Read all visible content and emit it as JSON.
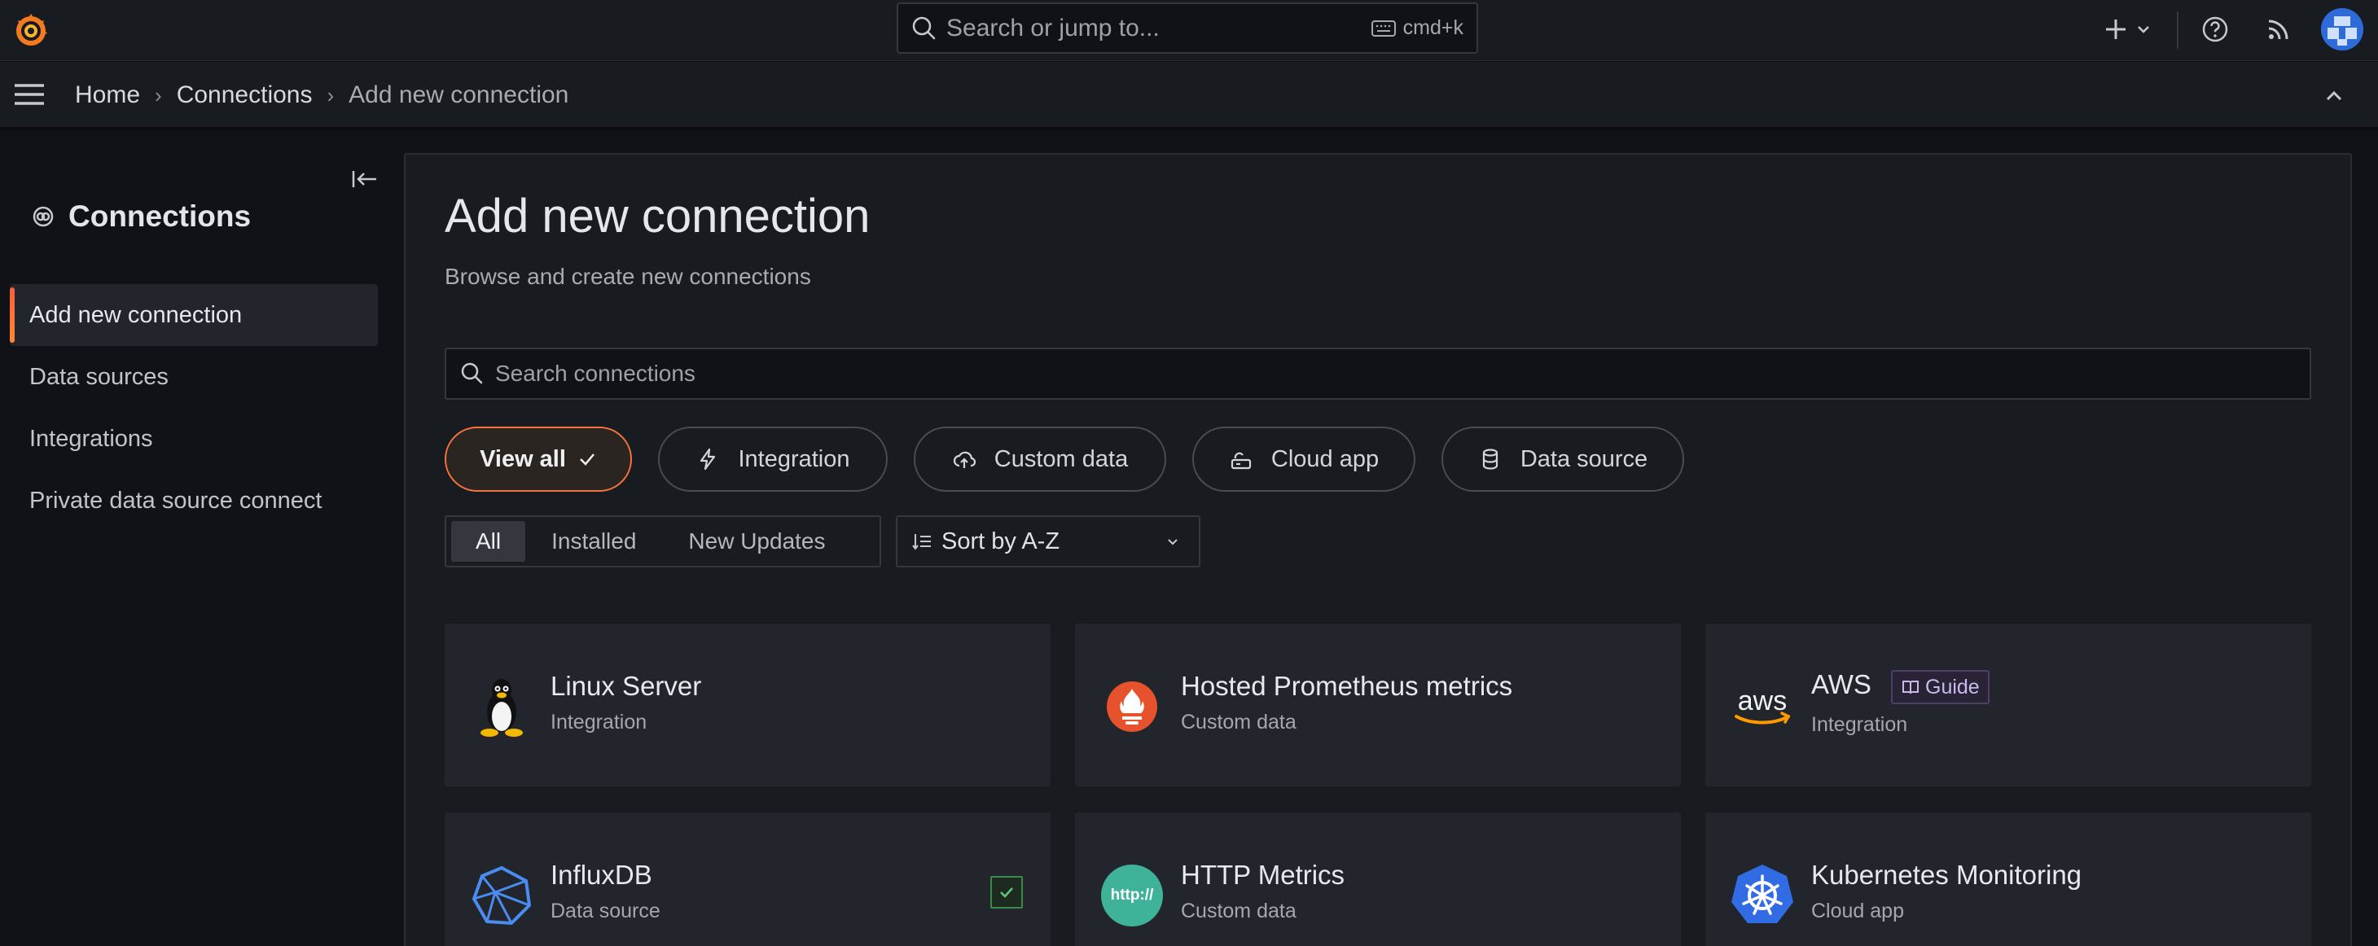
{
  "topbar": {
    "search_placeholder": "Search or jump to...",
    "shortcut": "cmd+k"
  },
  "breadcrumb": [
    {
      "label": "Home"
    },
    {
      "label": "Connections"
    },
    {
      "label": "Add new connection"
    }
  ],
  "sidebar": {
    "title": "Connections",
    "items": [
      {
        "label": "Add new connection",
        "active": true
      },
      {
        "label": "Data sources",
        "active": false
      },
      {
        "label": "Integrations",
        "active": false
      },
      {
        "label": "Private data source connect",
        "active": false
      }
    ]
  },
  "main": {
    "title": "Add new connection",
    "subtitle": "Browse and create new connections",
    "search_placeholder": "Search connections",
    "type_filters": [
      {
        "label": "View all",
        "icon": "check-icon",
        "active": true
      },
      {
        "label": "Integration",
        "icon": "bolt-icon",
        "active": false
      },
      {
        "label": "Custom data",
        "icon": "cloud-upload-icon",
        "active": false
      },
      {
        "label": "Cloud app",
        "icon": "cloud-app-icon",
        "active": false
      },
      {
        "label": "Data source",
        "icon": "database-icon",
        "active": false
      }
    ],
    "status_filters": [
      {
        "label": "All",
        "active": true
      },
      {
        "label": "Installed",
        "active": false
      },
      {
        "label": "New Updates",
        "active": false
      }
    ],
    "sort_label": "Sort by A-Z",
    "cards": [
      {
        "title": "Linux Server",
        "type": "Integration",
        "logo": "linux-tux-icon"
      },
      {
        "title": "Hosted Prometheus metrics",
        "type": "Custom data",
        "logo": "prometheus-icon"
      },
      {
        "title": "AWS",
        "type": "Integration",
        "logo": "aws-icon",
        "badge": "Guide"
      },
      {
        "title": "InfluxDB",
        "type": "Data source",
        "logo": "influxdb-icon",
        "installed": true
      },
      {
        "title": "HTTP Metrics",
        "type": "Custom data",
        "logo": "http-icon",
        "logo_text": "http://"
      },
      {
        "title": "Kubernetes Monitoring",
        "type": "Cloud app",
        "logo": "kubernetes-icon"
      }
    ]
  },
  "colors": {
    "accent": "#f5723e",
    "background": "#111217",
    "panel": "#181b1f",
    "card": "#22252b"
  }
}
